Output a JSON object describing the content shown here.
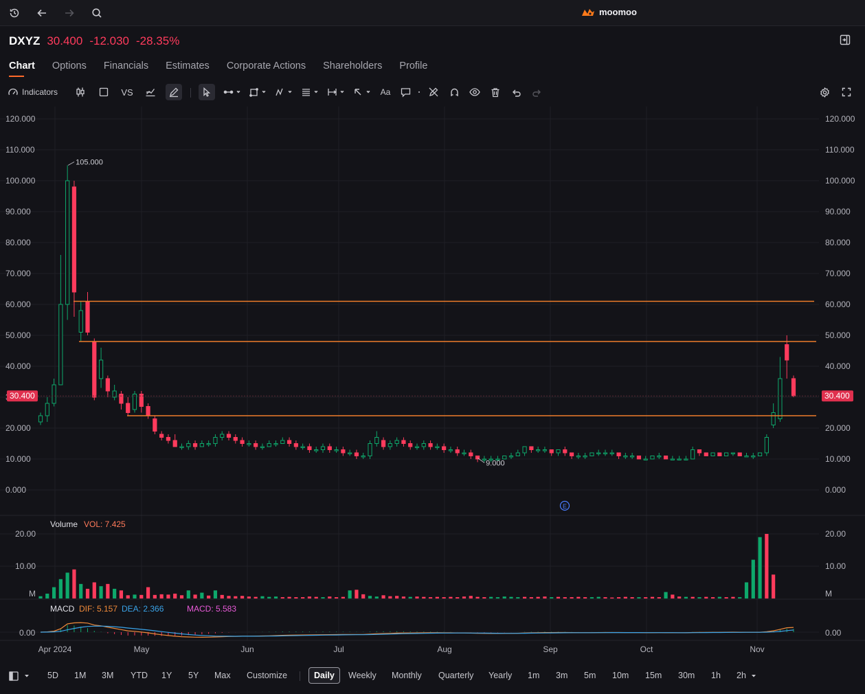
{
  "topbar": {
    "icons": [
      "history-icon",
      "back-arrow-icon",
      "forward-arrow-icon",
      "search-icon"
    ],
    "brand": "moomoo"
  },
  "quote": {
    "symbol": "DXYZ",
    "price": "30.400",
    "change": "-12.030",
    "change_pct": "-28.35%"
  },
  "tabs": [
    {
      "label": "Chart",
      "active": true
    },
    {
      "label": "Options"
    },
    {
      "label": "Financials"
    },
    {
      "label": "Estimates"
    },
    {
      "label": "Corporate Actions"
    },
    {
      "label": "Shareholders"
    },
    {
      "label": "Profile"
    }
  ],
  "toolbar": {
    "indicators_label": "Indicators",
    "vs_label": "VS",
    "text_tool_label": "Aa"
  },
  "chart_data": [
    {
      "type": "candlestick",
      "x_labels": [
        "Apr 2024",
        "May",
        "Jun",
        "Jul",
        "Aug",
        "Sep",
        "Oct",
        "Nov"
      ],
      "y_ticks": [
        "120.000",
        "110.000",
        "100.000",
        "90.000",
        "80.000",
        "70.000",
        "60.000",
        "50.000",
        "40.000",
        "30.000",
        "20.000",
        "10.000",
        "0.000"
      ],
      "ylim": [
        0,
        120
      ],
      "current_price_label": "30.400",
      "high_annotation": "105.000",
      "low_annotation": "9.000",
      "horizontal_lines": [
        61.0,
        48.0,
        24.0
      ],
      "earnings_marker": "E",
      "colors": {
        "up": "#0ea86b",
        "down": "#ff3b5c",
        "line": "#f07d2a"
      },
      "candles": [
        [
          22.0,
          24.0,
          25.0,
          21.0
        ],
        [
          24.0,
          28.0,
          30.0,
          22.0
        ],
        [
          28.0,
          34.0,
          36.0,
          27.0
        ],
        [
          34.0,
          60.0,
          76.0,
          41.0
        ],
        [
          60.0,
          100.0,
          105.0,
          55.0
        ],
        [
          98.0,
          64.0,
          100.0,
          56.0
        ],
        [
          51.0,
          58.0,
          61.0,
          48.0
        ],
        [
          61.0,
          51.0,
          64.0,
          50.0
        ],
        [
          48.0,
          30.0,
          49.0,
          29.0
        ],
        [
          36.0,
          42.0,
          46.0,
          33.0
        ],
        [
          36.0,
          32.0,
          37.0,
          30.0
        ],
        [
          30.0,
          32.0,
          34.0,
          29.0
        ],
        [
          31.0,
          28.0,
          32.0,
          26.0
        ],
        [
          28.0,
          25.0,
          30.0,
          24.0
        ],
        [
          26.0,
          31.0,
          32.0,
          25.0
        ],
        [
          31.0,
          27.0,
          32.0,
          25.0
        ],
        [
          27.0,
          24.0,
          28.0,
          23.0
        ],
        [
          23.0,
          19.0,
          24.0,
          18.0
        ],
        [
          18.0,
          17.0,
          19.0,
          16.0
        ],
        [
          17.0,
          16.0,
          18.0,
          15.0
        ],
        [
          16.0,
          14.0,
          18.0,
          14.0
        ],
        [
          14.0,
          14.0,
          15.0,
          13.0
        ],
        [
          14.0,
          15.0,
          16.0,
          13.0
        ],
        [
          15.0,
          14.0,
          16.0,
          13.0
        ],
        [
          14.0,
          15.0,
          16.0,
          14.0
        ],
        [
          15.0,
          15.0,
          16.0,
          14.0
        ],
        [
          15.0,
          17.0,
          18.0,
          14.0
        ],
        [
          17.0,
          18.0,
          19.0,
          16.0
        ],
        [
          18.0,
          17.0,
          19.0,
          16.0
        ],
        [
          17.0,
          16.0,
          18.0,
          15.0
        ],
        [
          16.0,
          15.0,
          17.0,
          14.0
        ],
        [
          15.0,
          15.0,
          16.0,
          14.0
        ],
        [
          15.0,
          14.0,
          16.0,
          13.0
        ],
        [
          14.0,
          14.0,
          15.0,
          13.0
        ],
        [
          14.0,
          15.0,
          16.0,
          14.0
        ],
        [
          15.0,
          15.0,
          16.0,
          14.0
        ],
        [
          15.0,
          16.0,
          17.0,
          15.0
        ],
        [
          16.0,
          15.0,
          17.0,
          14.0
        ],
        [
          15.0,
          14.0,
          16.0,
          13.0
        ],
        [
          14.0,
          14.0,
          15.0,
          13.0
        ],
        [
          14.0,
          13.0,
          15.0,
          12.0
        ],
        [
          13.0,
          13.0,
          14.0,
          12.0
        ],
        [
          13.0,
          14.0,
          15.0,
          12.0
        ],
        [
          14.0,
          13.0,
          15.0,
          12.0
        ],
        [
          13.0,
          13.0,
          14.0,
          12.0
        ],
        [
          13.0,
          12.0,
          14.0,
          11.0
        ],
        [
          12.0,
          12.0,
          13.0,
          11.0
        ],
        [
          12.0,
          11.0,
          13.0,
          10.0
        ],
        [
          11.0,
          11.0,
          12.0,
          10.0
        ],
        [
          11.0,
          15.0,
          16.0,
          10.0
        ],
        [
          15.0,
          17.0,
          19.0,
          14.0
        ],
        [
          16.0,
          14.0,
          17.0,
          13.0
        ],
        [
          14.0,
          15.0,
          16.0,
          13.0
        ],
        [
          15.0,
          16.0,
          17.0,
          14.0
        ],
        [
          16.0,
          15.0,
          17.0,
          14.0
        ],
        [
          15.0,
          14.0,
          16.0,
          13.0
        ],
        [
          14.0,
          14.0,
          15.0,
          13.0
        ],
        [
          14.0,
          15.0,
          16.0,
          13.0
        ],
        [
          15.0,
          14.0,
          16.0,
          13.0
        ],
        [
          14.0,
          14.0,
          15.0,
          13.0
        ],
        [
          14.0,
          13.0,
          15.0,
          12.0
        ],
        [
          13.0,
          13.0,
          14.0,
          12.0
        ],
        [
          13.0,
          12.0,
          14.0,
          11.0
        ],
        [
          12.0,
          12.0,
          13.0,
          11.0
        ],
        [
          12.0,
          11.0,
          13.0,
          10.0
        ],
        [
          11.0,
          10.0,
          11.0,
          9.0
        ],
        [
          10.0,
          10.0,
          11.0,
          9.0
        ],
        [
          10.0,
          10.0,
          11.0,
          9.0
        ],
        [
          10.0,
          10.0,
          11.0,
          10.0
        ],
        [
          10.0,
          11.0,
          11.0,
          10.0
        ],
        [
          11.0,
          11.0,
          12.0,
          10.0
        ],
        [
          11.0,
          12.0,
          13.0,
          11.0
        ],
        [
          12.0,
          14.0,
          14.0,
          11.0
        ],
        [
          14.0,
          13.0,
          14.0,
          12.0
        ],
        [
          13.0,
          13.0,
          14.0,
          12.0
        ],
        [
          13.0,
          13.0,
          14.0,
          12.0
        ],
        [
          13.0,
          12.0,
          13.0,
          11.0
        ],
        [
          12.0,
          13.0,
          13.0,
          11.0
        ],
        [
          13.0,
          12.0,
          14.0,
          11.0
        ],
        [
          12.0,
          11.0,
          12.0,
          10.0
        ],
        [
          11.0,
          11.0,
          12.0,
          10.0
        ],
        [
          11.0,
          11.0,
          12.0,
          10.0
        ],
        [
          11.0,
          12.0,
          12.0,
          11.0
        ],
        [
          12.0,
          12.0,
          13.0,
          11.0
        ],
        [
          12.0,
          12.0,
          13.0,
          11.0
        ],
        [
          12.0,
          12.0,
          13.0,
          11.0
        ],
        [
          12.0,
          11.0,
          12.0,
          10.0
        ],
        [
          11.0,
          11.0,
          12.0,
          10.0
        ],
        [
          11.0,
          11.0,
          12.0,
          10.0
        ],
        [
          11.0,
          10.0,
          11.0,
          10.0
        ],
        [
          10.0,
          10.0,
          11.0,
          10.0
        ],
        [
          10.0,
          11.0,
          11.0,
          10.0
        ],
        [
          11.0,
          11.0,
          12.0,
          10.0
        ],
        [
          11.0,
          10.0,
          11.0,
          10.0
        ],
        [
          10.0,
          10.0,
          11.0,
          10.0
        ],
        [
          10.0,
          10.0,
          11.0,
          10.0
        ],
        [
          10.0,
          10.0,
          11.0,
          10.0
        ],
        [
          10.0,
          13.0,
          14.0,
          10.0
        ],
        [
          13.0,
          12.0,
          13.0,
          11.0
        ],
        [
          12.0,
          11.0,
          12.0,
          11.0
        ],
        [
          11.0,
          12.0,
          12.0,
          11.0
        ],
        [
          12.0,
          11.0,
          12.0,
          11.0
        ],
        [
          11.0,
          12.0,
          12.0,
          11.0
        ],
        [
          12.0,
          12.0,
          12.0,
          11.0
        ],
        [
          12.0,
          11.0,
          12.0,
          11.0
        ],
        [
          11.0,
          11.0,
          12.0,
          11.0
        ],
        [
          11.0,
          11.0,
          12.0,
          10.0
        ],
        [
          11.0,
          12.0,
          12.0,
          11.0
        ],
        [
          12.0,
          17.0,
          18.0,
          11.0
        ],
        [
          21.0,
          25.0,
          28.0,
          20.0
        ],
        [
          23.0,
          36.0,
          43.0,
          22.0
        ],
        [
          47.0,
          42.0,
          50.0,
          36.0
        ],
        [
          36.0,
          30.4,
          37.0,
          30.0
        ]
      ]
    },
    {
      "type": "bar",
      "title": "Volume",
      "indicator_label": "VOL: 7.425",
      "unit": "M",
      "y_ticks": [
        "20.00",
        "10.00"
      ],
      "ylim": [
        0,
        20
      ],
      "values": [
        0.7,
        1.5,
        3.5,
        6.0,
        8.0,
        9.0,
        4.5,
        3.0,
        5.0,
        3.8,
        4.5,
        3.0,
        2.5,
        1.0,
        1.2,
        1.1,
        3.5,
        1.1,
        1.3,
        1.2,
        1.5,
        1.0,
        2.5,
        1.2,
        1.8,
        0.9,
        2.5,
        1.1,
        0.8,
        0.7,
        0.8,
        0.6,
        0.5,
        0.7,
        0.5,
        0.6,
        0.4,
        0.5,
        0.4,
        0.4,
        0.6,
        0.5,
        0.4,
        0.6,
        0.4,
        0.5,
        2.5,
        2.7,
        1.3,
        0.8,
        0.6,
        1.0,
        0.7,
        0.8,
        0.6,
        0.5,
        0.6,
        0.5,
        0.4,
        0.5,
        0.4,
        0.5,
        0.4,
        0.6,
        0.8,
        0.5,
        0.4,
        0.5,
        0.4,
        0.6,
        0.5,
        0.4,
        0.5,
        0.4,
        0.5,
        0.6,
        0.4,
        0.5,
        0.4,
        0.4,
        0.5,
        0.4,
        0.4,
        0.5,
        0.4,
        0.3,
        0.4,
        0.5,
        0.4,
        0.4,
        0.4,
        0.5,
        0.4,
        2.0,
        1.2,
        0.6,
        0.5,
        0.5,
        0.4,
        0.5,
        0.4,
        0.5,
        0.4,
        0.5,
        0.4,
        5.0,
        12.0,
        19.0,
        20.0,
        7.4
      ],
      "colors": [
        "up",
        "up",
        "up",
        "up",
        "up",
        "down",
        "up",
        "down",
        "down",
        "up",
        "down",
        "up",
        "down",
        "down",
        "up",
        "down",
        "down",
        "down",
        "down",
        "down",
        "down",
        "down",
        "up",
        "down",
        "up",
        "down",
        "up",
        "down",
        "down",
        "down",
        "down",
        "down",
        "down",
        "up",
        "up",
        "up",
        "down",
        "down",
        "down",
        "down",
        "down",
        "down",
        "up",
        "down",
        "down",
        "down",
        "up",
        "down",
        "down",
        "up",
        "up",
        "down",
        "down",
        "down",
        "down",
        "up",
        "down",
        "down",
        "down",
        "down",
        "down",
        "down",
        "down",
        "down",
        "down",
        "down",
        "down",
        "up",
        "up",
        "up",
        "up",
        "up",
        "down",
        "down",
        "down",
        "down",
        "up",
        "down",
        "down",
        "down",
        "down",
        "down",
        "up",
        "up",
        "down",
        "down",
        "down",
        "down",
        "down",
        "up",
        "down",
        "down",
        "down",
        "up",
        "down",
        "down",
        "up",
        "down",
        "up",
        "down",
        "down",
        "up",
        "down",
        "down",
        "up",
        "up",
        "up",
        "up",
        "down",
        "down"
      ]
    },
    {
      "type": "line",
      "title": "MACD",
      "series": [
        {
          "name": "DIF: 5.157",
          "color": "#f08a3a"
        },
        {
          "name": "DEA: 2.366",
          "color": "#3aa3e8"
        },
        {
          "name": "MACD: 5.583",
          "color": "#e85ad8"
        }
      ],
      "y_ticks": [
        "0.00"
      ]
    }
  ],
  "bottom": {
    "periods": [
      {
        "label": "5D"
      },
      {
        "label": "1M"
      },
      {
        "label": "3M"
      },
      {
        "label": "YTD"
      },
      {
        "label": "1Y"
      },
      {
        "label": "5Y"
      },
      {
        "label": "Max"
      },
      {
        "label": "Customize"
      }
    ],
    "intervals": [
      {
        "label": "Daily",
        "active": true
      },
      {
        "label": "Weekly"
      },
      {
        "label": "Monthly"
      },
      {
        "label": "Quarterly"
      },
      {
        "label": "Yearly"
      },
      {
        "label": "1m"
      },
      {
        "label": "3m"
      },
      {
        "label": "5m"
      },
      {
        "label": "10m"
      },
      {
        "label": "15m"
      },
      {
        "label": "30m"
      },
      {
        "label": "1h"
      },
      {
        "label": "2h"
      }
    ]
  }
}
